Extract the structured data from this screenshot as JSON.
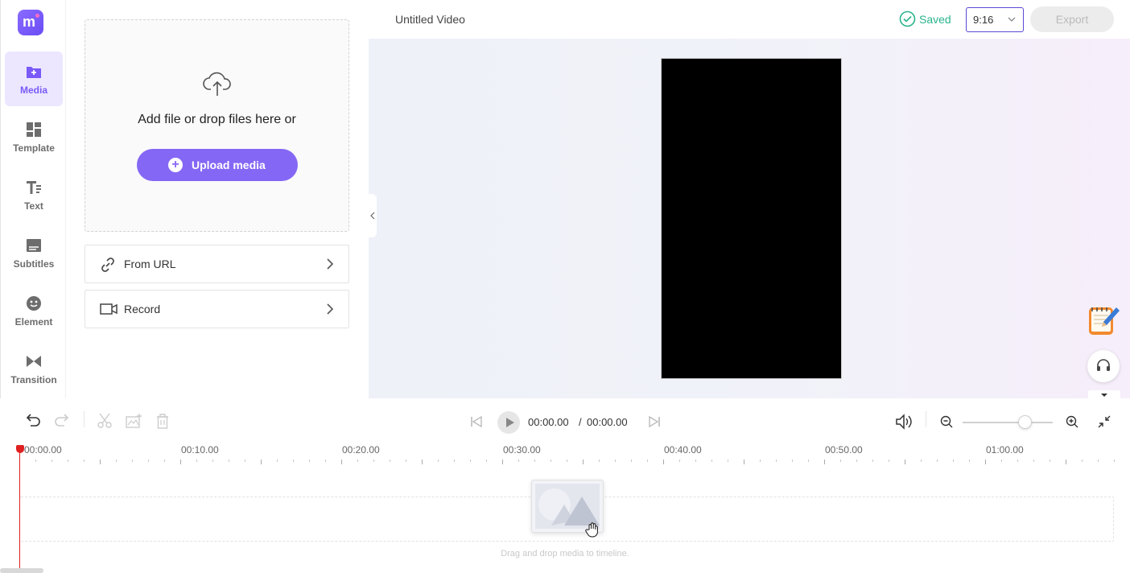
{
  "app": {
    "brand": "m"
  },
  "nav": {
    "items": [
      {
        "label": "Media",
        "icon": "media-folder-icon",
        "active": true
      },
      {
        "label": "Template",
        "icon": "template-grid-icon"
      },
      {
        "label": "Text",
        "icon": "text-icon"
      },
      {
        "label": "Subtitles",
        "icon": "subtitles-icon"
      },
      {
        "label": "Element",
        "icon": "element-icon"
      },
      {
        "label": "Transition",
        "icon": "transition-icon"
      }
    ]
  },
  "media_panel": {
    "drop_text": "Add file or drop files here or",
    "upload_label": "Upload media",
    "from_url_label": "From URL",
    "record_label": "Record"
  },
  "header": {
    "title": "Untitled Video",
    "saved_label": "Saved",
    "aspect_ratio": "9:16",
    "export_label": "Export"
  },
  "player": {
    "current_time": "00:00.00",
    "separator": "/",
    "total_time": "00:00.00"
  },
  "timeline": {
    "ticks": [
      "00:00.00",
      "00:10.00",
      "00:20.00",
      "00:30.00",
      "00:40.00",
      "00:50.00",
      "01:00.00"
    ],
    "drop_hint": "Drag and drop media to timeline."
  },
  "colors": {
    "accent": "#8567f5",
    "saved": "#2ab48d",
    "playhead": "#e02020"
  }
}
